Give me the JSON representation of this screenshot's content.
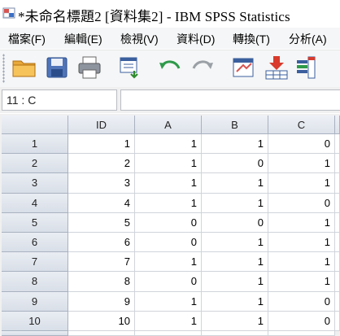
{
  "window": {
    "title": "*未命名標題2 [資料集2] - IBM SPSS Statistics"
  },
  "menu": [
    {
      "label": "檔案(F)"
    },
    {
      "label": "編輯(E)"
    },
    {
      "label": "檢視(V)"
    },
    {
      "label": "資料(D)"
    },
    {
      "label": "轉換(T)"
    },
    {
      "label": "分析(A)"
    }
  ],
  "toolbar": {
    "icons": [
      "open-folder-icon",
      "save-icon",
      "print-icon",
      "dialog-recall-icon",
      "undo-icon",
      "redo-icon",
      "goto-case-icon",
      "insert-case-icon",
      "variables-icon"
    ]
  },
  "cell_editor": {
    "reference": "11 : C",
    "value": ""
  },
  "grid": {
    "columns": [
      "ID",
      "A",
      "B",
      "C"
    ],
    "rows": [
      {
        "num": "1",
        "cells": [
          "1",
          "1",
          "1",
          "0"
        ]
      },
      {
        "num": "2",
        "cells": [
          "2",
          "1",
          "0",
          "1"
        ]
      },
      {
        "num": "3",
        "cells": [
          "3",
          "1",
          "1",
          "1"
        ]
      },
      {
        "num": "4",
        "cells": [
          "4",
          "1",
          "1",
          "0"
        ]
      },
      {
        "num": "5",
        "cells": [
          "5",
          "0",
          "0",
          "1"
        ]
      },
      {
        "num": "6",
        "cells": [
          "6",
          "0",
          "1",
          "1"
        ]
      },
      {
        "num": "7",
        "cells": [
          "7",
          "1",
          "1",
          "1"
        ]
      },
      {
        "num": "8",
        "cells": [
          "8",
          "0",
          "1",
          "1"
        ]
      },
      {
        "num": "9",
        "cells": [
          "9",
          "1",
          "1",
          "0"
        ]
      },
      {
        "num": "10",
        "cells": [
          "10",
          "1",
          "1",
          "0"
        ]
      }
    ]
  },
  "colors": {
    "menubar": "#f5f6f7",
    "header": "#dde2ea",
    "grid_line": "#d0d4da"
  }
}
